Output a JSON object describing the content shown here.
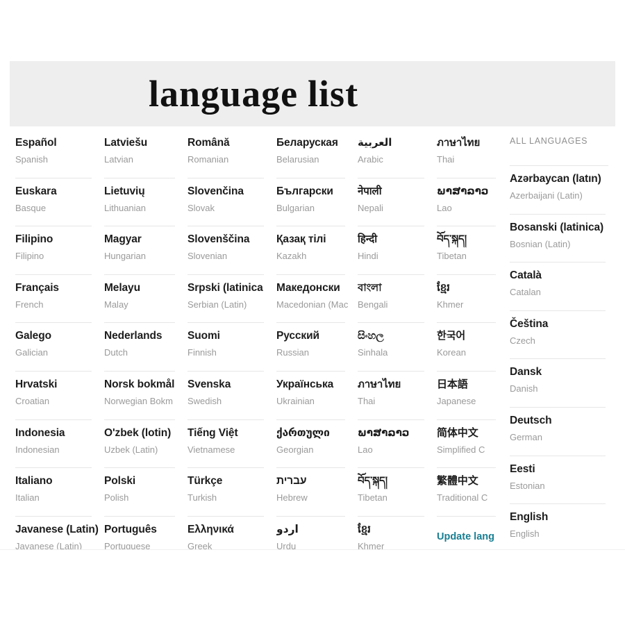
{
  "header": {
    "title_part1": "language",
    "title_part2": "list",
    "band_color": "#eeeeee"
  },
  "colors": {
    "native_text": "#1c1c1c",
    "english_text": "#9a9a9a",
    "divider": "#e6e6e6",
    "link": "#1a7f93",
    "page_background": "#ffffff"
  },
  "columns": [
    {
      "index": 0,
      "items": [
        {
          "native": "Español",
          "english": "Spanish"
        },
        {
          "native": "Euskara",
          "english": "Basque"
        },
        {
          "native": "Filipino",
          "english": "Filipino"
        },
        {
          "native": "Français",
          "english": "French"
        },
        {
          "native": "Galego",
          "english": "Galician"
        },
        {
          "native": "Hrvatski",
          "english": "Croatian"
        },
        {
          "native": "Indonesia",
          "english": "Indonesian"
        },
        {
          "native": "Italiano",
          "english": "Italian"
        },
        {
          "native": "Javanese (Latin)",
          "english": "Javanese (Latin)"
        }
      ]
    },
    {
      "index": 1,
      "items": [
        {
          "native": "Latviešu",
          "english": "Latvian"
        },
        {
          "native": "Lietuvių",
          "english": "Lithuanian"
        },
        {
          "native": "Magyar",
          "english": "Hungarian"
        },
        {
          "native": "Melayu",
          "english": "Malay"
        },
        {
          "native": "Nederlands",
          "english": "Dutch"
        },
        {
          "native": "Norsk bokmål",
          "english": "Norwegian Bokm"
        },
        {
          "native": "O'zbek (lotin)",
          "english": "Uzbek (Latin)"
        },
        {
          "native": "Polski",
          "english": "Polish"
        },
        {
          "native": "Português",
          "english": "Portuguese"
        }
      ]
    },
    {
      "index": 2,
      "items": [
        {
          "native": "Română",
          "english": "Romanian"
        },
        {
          "native": "Slovenčina",
          "english": "Slovak"
        },
        {
          "native": "Slovenščina",
          "english": "Slovenian"
        },
        {
          "native": "Srpski (latinica",
          "english": "Serbian (Latin)"
        },
        {
          "native": "Suomi",
          "english": "Finnish"
        },
        {
          "native": "Svenska",
          "english": "Swedish"
        },
        {
          "native": "Tiếng Việt",
          "english": "Vietnamese"
        },
        {
          "native": "Türkçe",
          "english": "Turkish"
        },
        {
          "native": "Ελληνικά",
          "english": "Greek"
        }
      ]
    },
    {
      "index": 3,
      "items": [
        {
          "native": "Беларуская",
          "english": "Belarusian"
        },
        {
          "native": "Български",
          "english": "Bulgarian"
        },
        {
          "native": "Қазақ тілі",
          "english": "Kazakh"
        },
        {
          "native": "Македонски",
          "english": "Macedonian (Mac"
        },
        {
          "native": "Русский",
          "english": "Russian"
        },
        {
          "native": "Українська",
          "english": "Ukrainian"
        },
        {
          "native": "ქართული",
          "english": "Georgian"
        },
        {
          "native": "עברית",
          "english": "Hebrew",
          "rtl": true
        },
        {
          "native": "اردو",
          "english": "Urdu",
          "rtl": true
        }
      ]
    },
    {
      "index": 4,
      "items": [
        {
          "native": "العربية",
          "english": "Arabic",
          "rtl": true
        },
        {
          "native": "नेपाली",
          "english": "Nepali"
        },
        {
          "native": "हिन्दी",
          "english": "Hindi"
        },
        {
          "native": "বাংলা",
          "english": "Bengali"
        },
        {
          "native": "සිංහල",
          "english": "Sinhala"
        },
        {
          "native": "ภาษาไทย",
          "english": "Thai"
        },
        {
          "native": "ພາສາລາວ",
          "english": "Lao"
        },
        {
          "native": "བོད་སྐད།",
          "english": "Tibetan"
        },
        {
          "native": "ខ្មែរ",
          "english": "Khmer"
        }
      ]
    },
    {
      "index": 5,
      "items": [
        {
          "native": "ภาษาไทย",
          "english": "Thai"
        },
        {
          "native": "ພາສາລາວ",
          "english": "Lao"
        },
        {
          "native": "བོད་སྐད།",
          "english": "Tibetan"
        },
        {
          "native": "ខ្មែរ",
          "english": "Khmer"
        },
        {
          "native": "한국어",
          "english": "Korean"
        },
        {
          "native": "日本語",
          "english": "Japanese"
        },
        {
          "native": "简体中文",
          "english": "Simplified C"
        },
        {
          "native": "繁體中文",
          "english": "Traditional C"
        }
      ],
      "link": "Update lang"
    },
    {
      "index": 6,
      "section_header": "ALL LANGUAGES",
      "items": [
        {
          "native": "Azərbaycan (latın)",
          "english": "Azerbaijani (Latin)"
        },
        {
          "native": "Bosanski (latinica)",
          "english": "Bosnian (Latin)"
        },
        {
          "native": "Català",
          "english": "Catalan"
        },
        {
          "native": "Čeština",
          "english": "Czech"
        },
        {
          "native": "Dansk",
          "english": "Danish"
        },
        {
          "native": "Deutsch",
          "english": "German"
        },
        {
          "native": "Eesti",
          "english": "Estonian"
        },
        {
          "native": "English",
          "english": "English"
        }
      ]
    }
  ]
}
